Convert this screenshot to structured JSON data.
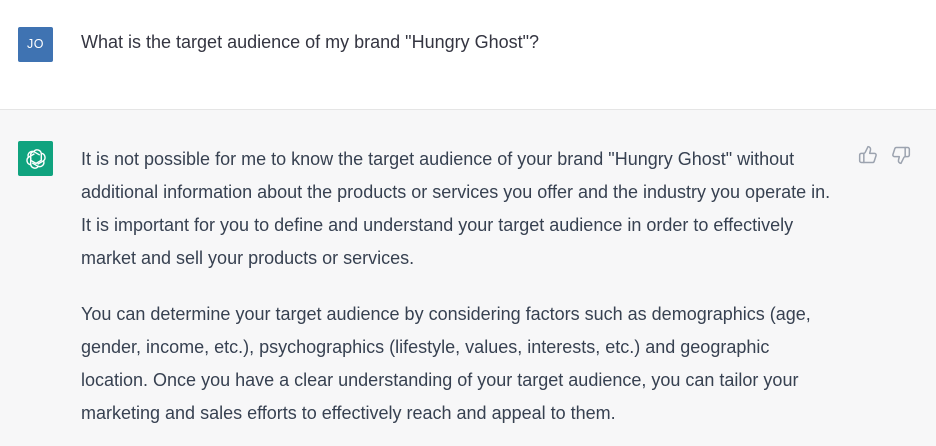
{
  "user_message": {
    "avatar_initials": "JO",
    "text": "What is the target audience of my brand \"Hungry Ghost\"?"
  },
  "assistant_message": {
    "avatar_icon": "openai-logo-icon",
    "paragraphs": [
      "It is not possible for me to know the target audience of your brand \"Hungry Ghost\" without additional information about the products or services you offer and the industry you operate in. It is important for you to define and understand your target audience in order to effectively market and sell your products or services.",
      "You can determine your target audience by considering factors such as demographics (age, gender, income, etc.), psychographics (lifestyle, values, interests, etc.) and geographic location. Once you have a clear understanding of your target audience, you can tailor your marketing and sales efforts to effectively reach and appeal to them."
    ],
    "feedback": {
      "thumbs_up_icon": "thumbs-up-icon",
      "thumbs_down_icon": "thumbs-down-icon"
    }
  },
  "colors": {
    "user_avatar": "#3f73b2",
    "assistant_avatar": "#10a37f",
    "assistant_background": "#f7f7f8",
    "text": "#374151"
  }
}
